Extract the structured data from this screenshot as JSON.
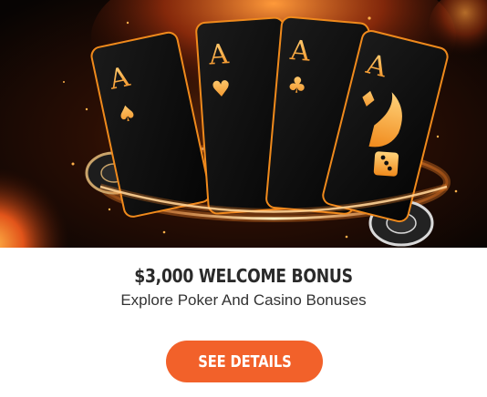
{
  "promo": {
    "title": "$3,000 WELCOME BONUS",
    "subtitle": "Explore Poker And Casino Bonuses",
    "cta_label": "SEE DETAILS",
    "accent_color": "#f2612a"
  },
  "hero": {
    "cards": [
      {
        "rank": "A",
        "suit": "spade-icon",
        "glyph": "♠"
      },
      {
        "rank": "A",
        "suit": "heart-icon",
        "glyph": "♥"
      },
      {
        "rank": "A",
        "suit": "club-icon",
        "glyph": "♣"
      },
      {
        "rank": "A",
        "suit": "diamond-icon",
        "glyph": "♦"
      }
    ]
  }
}
